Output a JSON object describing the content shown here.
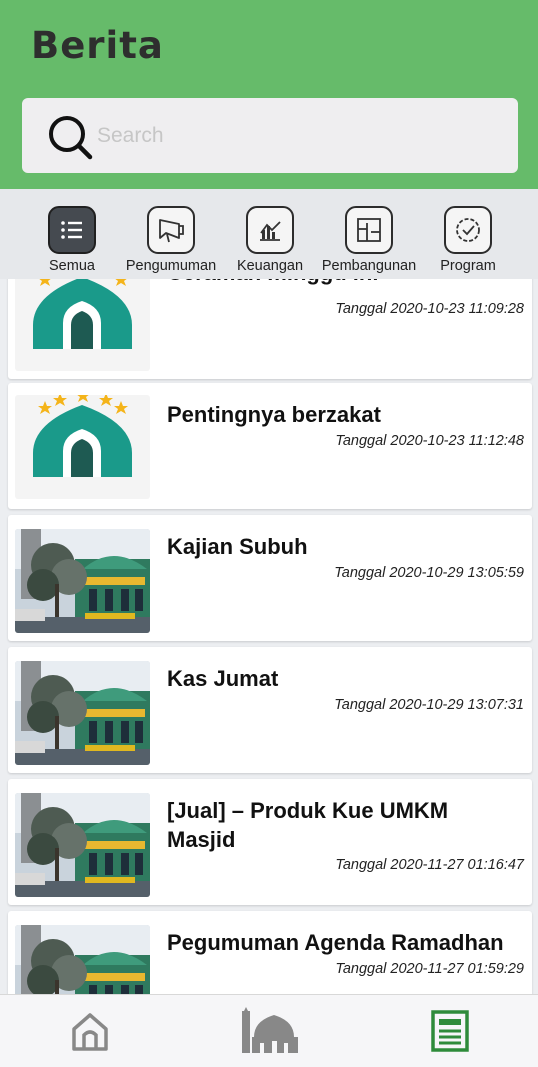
{
  "header": {
    "title": "Berita"
  },
  "search": {
    "placeholder": "Search",
    "icon": "search-icon"
  },
  "categories": [
    {
      "label": "Semua",
      "icon": "list-icon",
      "active": true
    },
    {
      "label": "Pengumuman",
      "icon": "megaphone-icon",
      "active": false
    },
    {
      "label": "Keuangan",
      "icon": "finance-chart-icon",
      "active": false
    },
    {
      "label": "Pembangunan",
      "icon": "floorplan-icon",
      "active": false
    },
    {
      "label": "Program",
      "icon": "check-circle-icon",
      "active": false
    }
  ],
  "news": [
    {
      "title": "Ceramah minggu ini",
      "date": "Tanggal 2020-10-23 11:09:28",
      "thumb": "mosque-logo"
    },
    {
      "title": "Pentingnya berzakat",
      "date": "Tanggal 2020-10-23 11:12:48",
      "thumb": "mosque-logo"
    },
    {
      "title": "Kajian Subuh",
      "date": "Tanggal 2020-10-29 13:05:59",
      "thumb": "mosque-photo"
    },
    {
      "title": "Kas Jumat",
      "date": "Tanggal 2020-10-29 13:07:31",
      "thumb": "mosque-photo"
    },
    {
      "title": "[Jual] –  Produk Kue UMKM Masjid",
      "date": "Tanggal 2020-11-27 01:16:47",
      "thumb": "mosque-photo"
    },
    {
      "title": "Pegumuman Agenda Ramadhan",
      "date": "Tanggal 2020-11-27 01:59:29",
      "thumb": "mosque-photo"
    }
  ],
  "bottom_nav": [
    {
      "icon": "home-icon",
      "active": false
    },
    {
      "icon": "mosque-icon",
      "active": false
    },
    {
      "icon": "news-icon",
      "active": true
    }
  ],
  "colors": {
    "header": "#66bb6a",
    "active_nav": "#2e8b3a",
    "logo_teal": "#1a9a8a",
    "star": "#f4b41a"
  }
}
